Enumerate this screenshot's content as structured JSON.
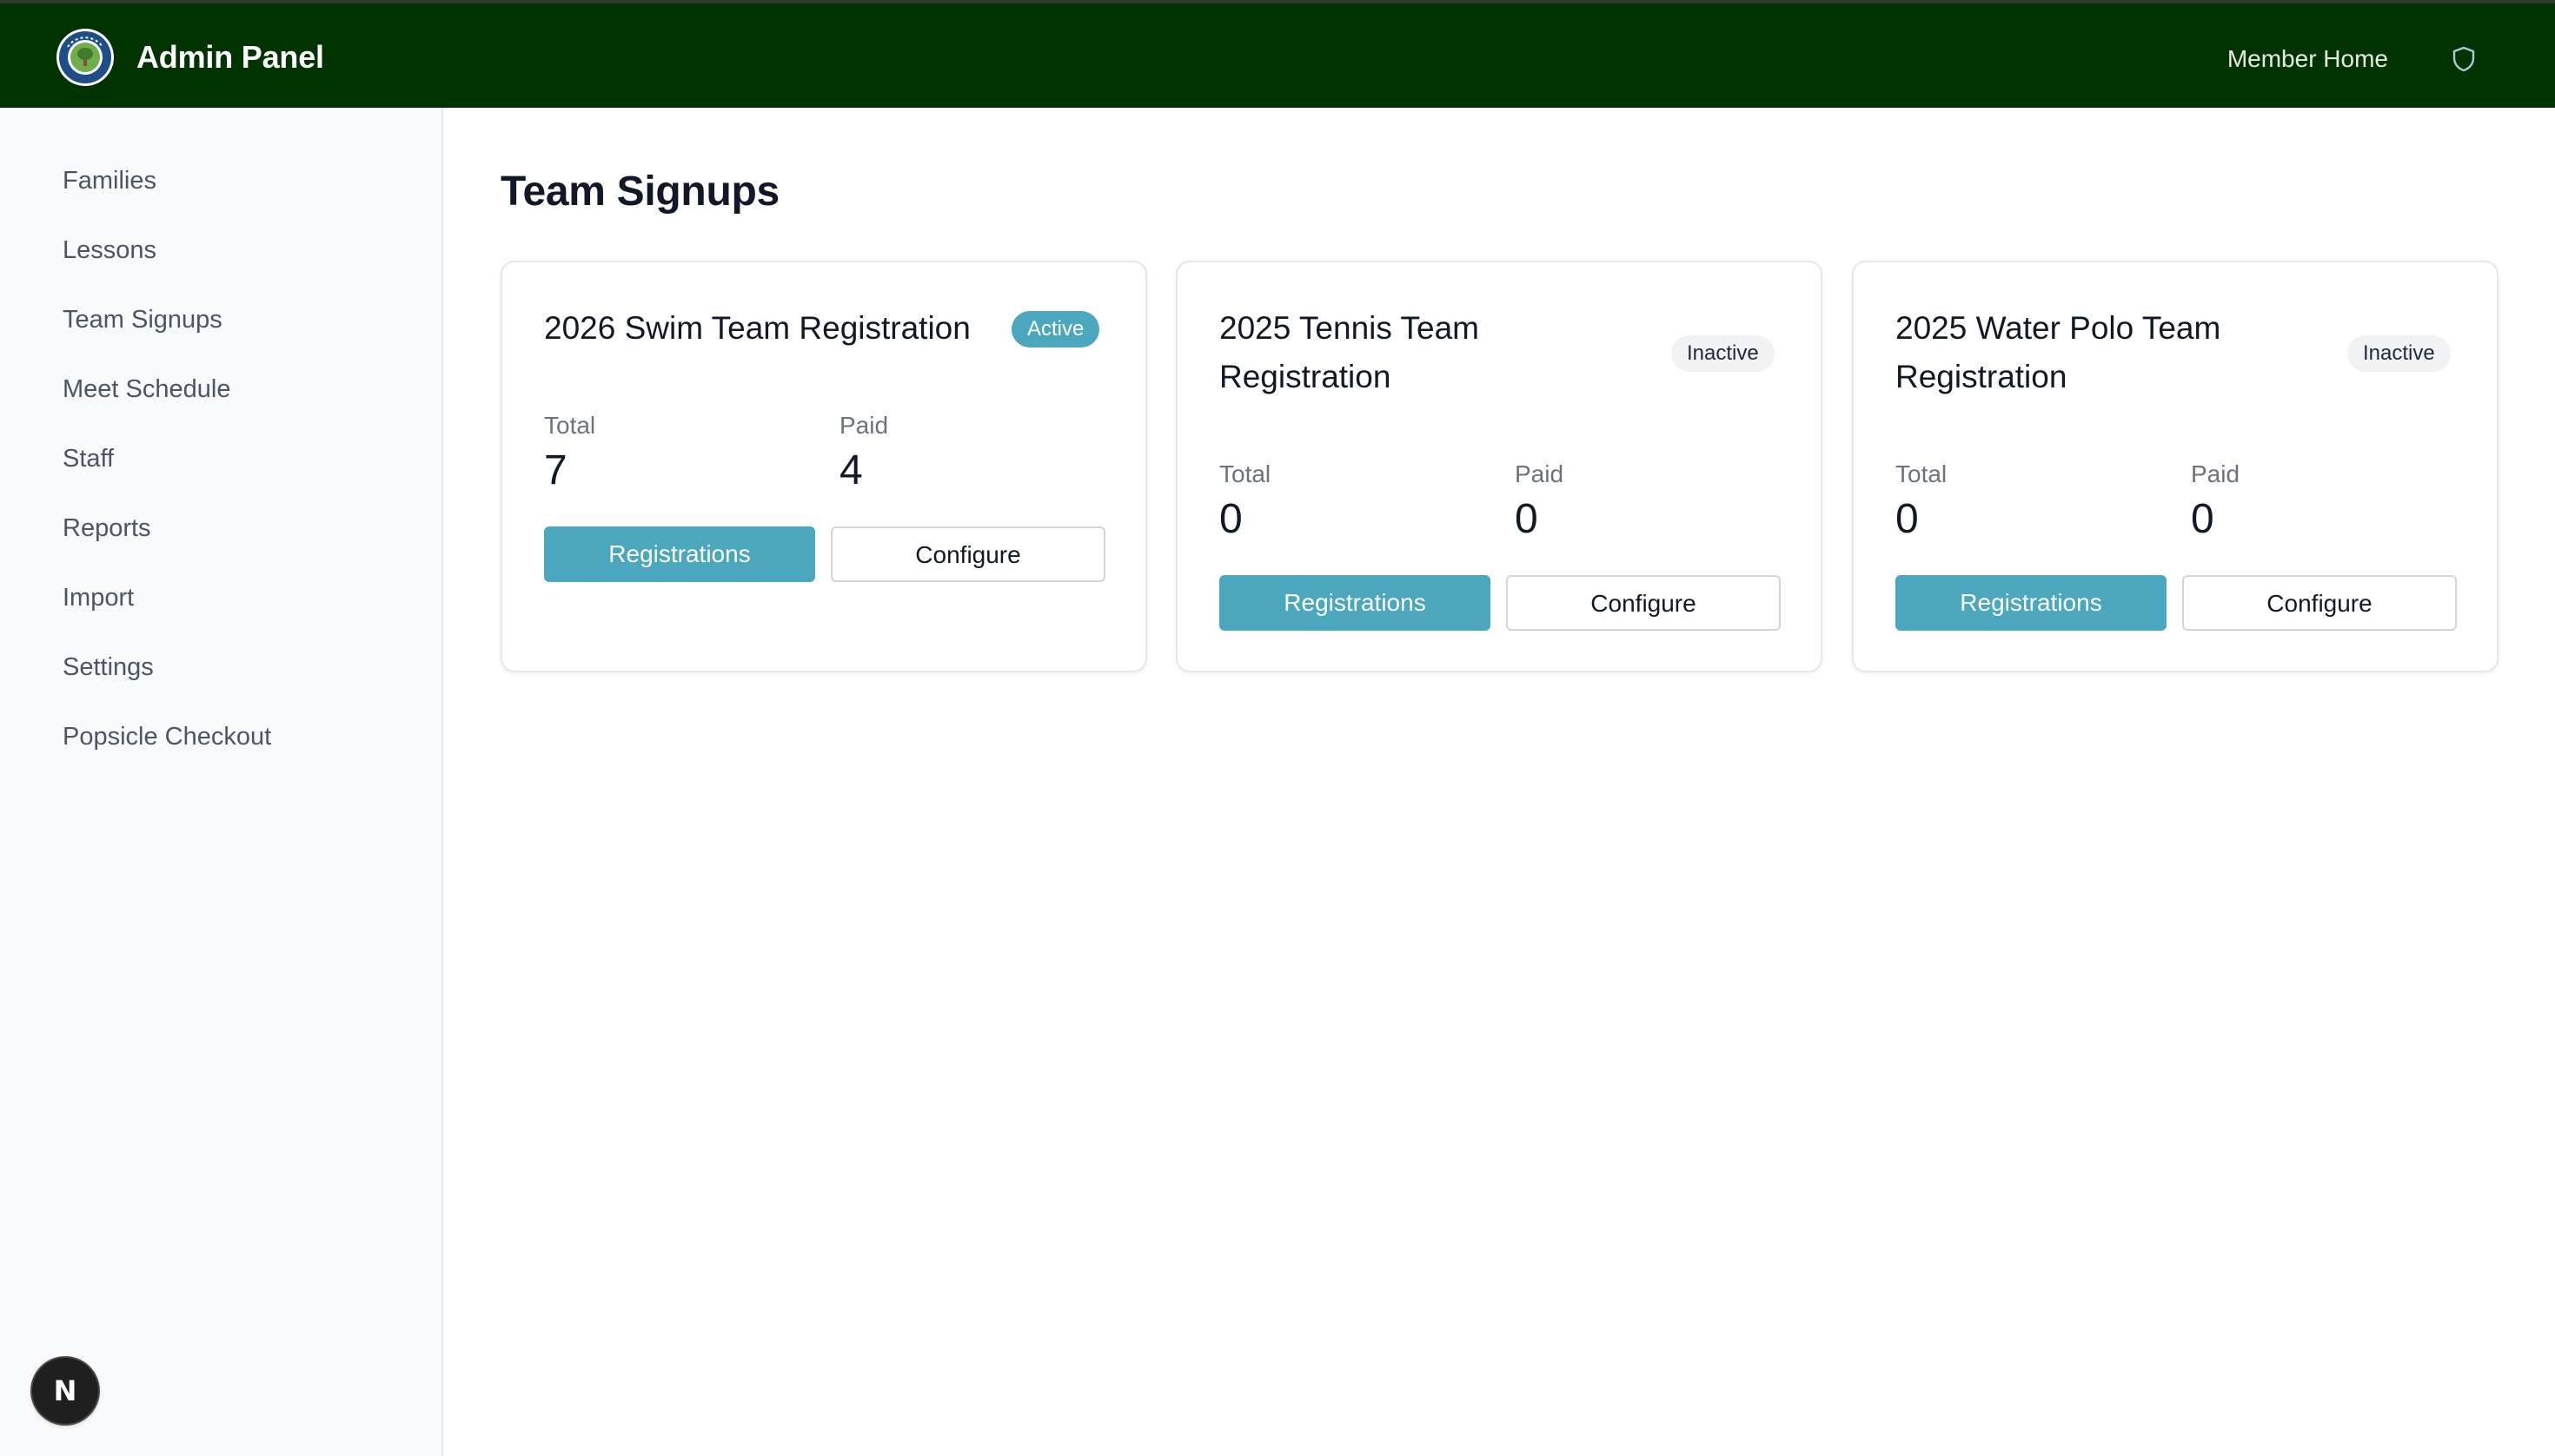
{
  "header": {
    "title": "Admin Panel",
    "member_home": "Member Home",
    "logo_icon": "club-logo-icon",
    "admin_icon": "shield-icon",
    "background_color": "#013300"
  },
  "sidebar": {
    "items": [
      {
        "label": "Families"
      },
      {
        "label": "Lessons"
      },
      {
        "label": "Team Signups"
      },
      {
        "label": "Meet Schedule"
      },
      {
        "label": "Staff"
      },
      {
        "label": "Reports"
      },
      {
        "label": "Import"
      },
      {
        "label": "Settings"
      },
      {
        "label": "Popsicle Checkout"
      }
    ]
  },
  "main": {
    "title": "Team Signups",
    "cards": [
      {
        "title_lines": [
          "2026 Swim Team Registration"
        ],
        "status": "Active",
        "total_label": "Total",
        "total": "7",
        "paid_label": "Paid",
        "paid": "4",
        "registrations_label": "Registrations",
        "configure_label": "Configure"
      },
      {
        "title_lines": [
          "2025 Tennis Team",
          "Registration"
        ],
        "status": "Inactive",
        "total_label": "Total",
        "total": "0",
        "paid_label": "Paid",
        "paid": "0",
        "registrations_label": "Registrations",
        "configure_label": "Configure"
      },
      {
        "title_lines": [
          "2025 Water Polo Team",
          "Registration"
        ],
        "status": "Inactive",
        "total_label": "Total",
        "total": "0",
        "paid_label": "Paid",
        "paid": "0",
        "registrations_label": "Registrations",
        "configure_label": "Configure"
      }
    ]
  },
  "dev_badge": {
    "letter": "N",
    "icon": "nextjs-icon"
  },
  "colors": {
    "accent": "#4aa7bd",
    "header": "#013300",
    "sidebar_bg": "#f8fafc"
  }
}
